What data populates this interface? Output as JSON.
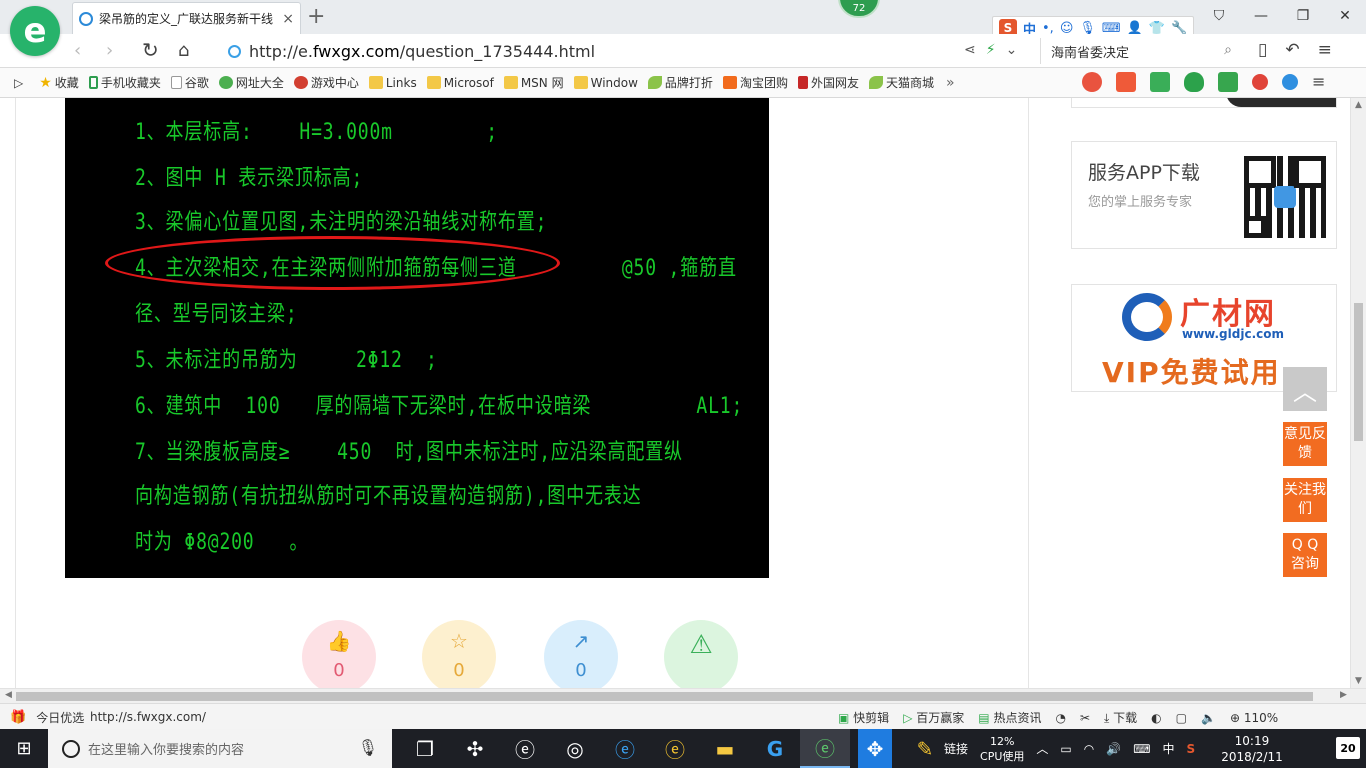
{
  "browser": {
    "tab_title": "梁吊筋的定义_广联达服务新干线",
    "tab_close": "×",
    "new_tab": "+",
    "badge_count": "72",
    "url_prefix": "http://e.",
    "url_domain": "fwxgx.com",
    "url_path": "/question_1735444.html",
    "search_text": "海南省委决定",
    "ime": {
      "logo": "S",
      "lang": "中",
      "punct": "•,"
    }
  },
  "bookmarks": [
    {
      "label": "收藏",
      "icon": "star-icon"
    },
    {
      "label": "手机收藏夹",
      "icon": "phone-icon"
    },
    {
      "label": "谷歌",
      "icon": "page-icon"
    },
    {
      "label": "网址大全",
      "icon": "green-globe-icon"
    },
    {
      "label": "游戏中心",
      "icon": "game-icon"
    },
    {
      "label": "Links",
      "icon": "folder-icon"
    },
    {
      "label": "Microsof",
      "icon": "folder-icon"
    },
    {
      "label": "MSN 网",
      "icon": "folder-icon"
    },
    {
      "label": "Window",
      "icon": "folder-icon"
    },
    {
      "label": "品牌打折",
      "icon": "leaf-icon"
    },
    {
      "label": "淘宝团购",
      "icon": "taobao-icon"
    },
    {
      "label": "外国网友",
      "icon": "flag-icon"
    },
    {
      "label": "天猫商城",
      "icon": "leaf-icon"
    }
  ],
  "cad_notes": [
    "1、本层标高:    H=3.000m        ;",
    "2、图中 H 表示梁顶标高;",
    "3、梁偏心位置见图,未注明的梁沿轴线对称布置;",
    "4、主次梁相交,在主梁两侧附加箍筋每侧三道         @50 ,箍筋直",
    "径、型号同该主梁;",
    "5、未标注的吊筋为     2Φ12  ;",
    "6、建筑中  100   厚的隔墙下无梁时,在板中设暗梁         AL1;",
    "7、当梁腹板高度≥    450  时,图中未标注时,应沿梁高配置纵",
    "向构造钢筋(有抗扭纵筋时可不再设置构造钢筋),图中无表达",
    "时为 Φ8@200   。"
  ],
  "actions": {
    "like_count": "0",
    "favorite_count": "0",
    "share_count": "0"
  },
  "sidebar": {
    "app_title": "服务APP下载",
    "app_subtitle": "您的掌上服务专家",
    "ad_brand": "广材网",
    "ad_site": "www.gldjc.com",
    "ad_slogan": "VIP免费试用"
  },
  "float_buttons": {
    "feedback": "意见反馈",
    "follow": "关注我们",
    "qq": "Q Q 咨询"
  },
  "statusbar": {
    "daily_pick": "今日优选",
    "hover_url": "http://s.fwxgx.com/",
    "quick_clip": "快剪辑",
    "millionaire": "百万赢家",
    "hot_news": "热点资讯",
    "download": "下载",
    "zoom": "110%"
  },
  "taskbar": {
    "search_placeholder": "在这里输入你要搜索的内容",
    "links": "链接",
    "cpu_percent": "12%",
    "cpu_label": "CPU使用",
    "ime_lang": "中",
    "time": "10:19",
    "date": "2018/2/11",
    "notifications": "20"
  }
}
